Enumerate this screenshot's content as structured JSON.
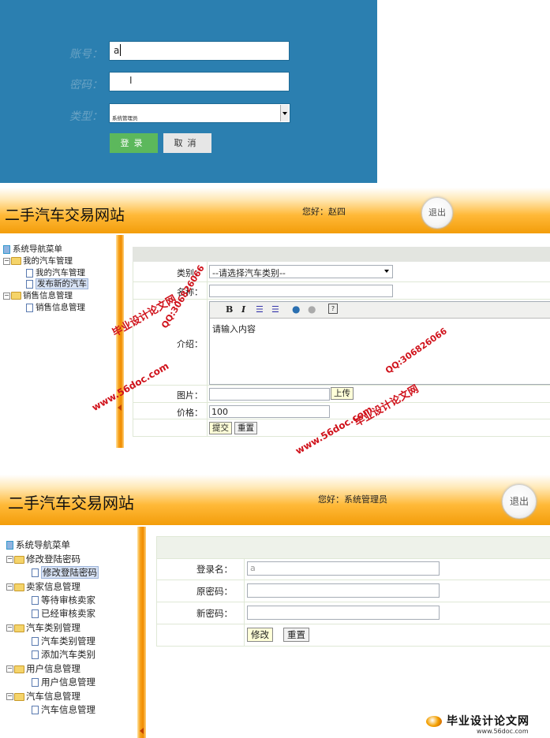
{
  "login": {
    "account_label": "账号：",
    "account_value": "a",
    "password_label": "密码：",
    "cursor_glyph": "I",
    "type_label": "类型：",
    "type_value": "系统管理员",
    "login_button": "登录",
    "cancel_button": "取消"
  },
  "screen2": {
    "site_title": "二手汽车交易网站",
    "greeting": "您好：赵四",
    "logout": "退出",
    "tree": {
      "root": "系统导航菜单",
      "groups": [
        {
          "label": "我的汽车管理",
          "items": [
            "我的汽车管理",
            "发布新的汽车"
          ]
        },
        {
          "label": "销售信息管理",
          "items": [
            "销售信息管理"
          ]
        }
      ]
    },
    "form": {
      "category_label": "类别：",
      "category_value": "--请选择汽车类别--",
      "name_label": "名称：",
      "intro_label": "介绍：",
      "intro_placeholder": "请输入内容",
      "image_label": "图片：",
      "upload_button": "上传",
      "price_label": "价格：",
      "price_value": "100",
      "submit_button": "提交",
      "reset_button": "重置"
    },
    "toolbar": [
      "B",
      "I",
      "ordered-list",
      "bullet-list",
      "link",
      "unlink",
      "help"
    ]
  },
  "screen3": {
    "site_title": "二手汽车交易网站",
    "greeting": "您好：系统管理员",
    "logout": "退出",
    "tree": {
      "root": "系统导航菜单",
      "groups": [
        {
          "label": "修改登陆密码",
          "items": [
            "修改登陆密码"
          ]
        },
        {
          "label": "卖家信息管理",
          "items": [
            "等待审核卖家",
            "已经审核卖家"
          ]
        },
        {
          "label": "汽车类别管理",
          "items": [
            "汽车类别管理",
            "添加汽车类别"
          ]
        },
        {
          "label": "用户信息管理",
          "items": [
            "用户信息管理"
          ]
        },
        {
          "label": "汽车信息管理",
          "items": [
            "汽车信息管理"
          ]
        }
      ]
    },
    "form": {
      "login_name_label": "登录名：",
      "login_name_value": "a",
      "old_pwd_label": "原密码：",
      "new_pwd_label": "新密码：",
      "modify_button": "修改",
      "reset_button": "重置"
    }
  },
  "watermarks": {
    "site": "www.56doc.com",
    "qq": "QQ:306826066",
    "brand": "毕业设计论文网",
    "footer_brand": "毕业设计论文网",
    "footer_url": "www.56doc.com"
  },
  "colors": {
    "login_bg": "#2b7fb0",
    "login_btn": "#5cb85c",
    "header_orange": "#f39d0a",
    "watermark_red": "#d0121b"
  }
}
